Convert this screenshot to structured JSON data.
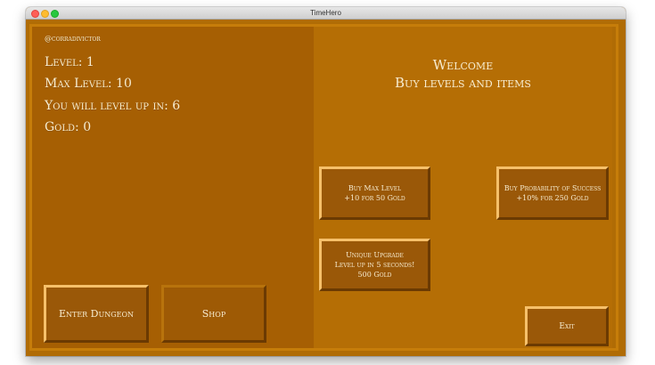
{
  "window": {
    "title": "TimeHero"
  },
  "player": {
    "username": "@corradivictor",
    "level": "Level: 1",
    "max_level": "Max Level: 10",
    "level_up": "You will level up in: 6",
    "gold": "Gold: 0"
  },
  "shop": {
    "welcome_line1": "Welcome",
    "welcome_line2": "Buy levels and items",
    "buy_max_level": {
      "line1": "Buy Max Level",
      "line2": "+10 for 50 Gold"
    },
    "buy_probability": {
      "line1": "Buy Probability of Success",
      "line2": "+10% for 250 Gold"
    },
    "unique_upgrade": {
      "line1": "Unique Upgrade",
      "line2": "Level up in 5 seconds!",
      "line3": "500 Gold"
    }
  },
  "actions": {
    "enter_dungeon": "Enter Dungeon",
    "shop": "Shop",
    "exit": "Exit"
  },
  "colors": {
    "background": "#b06c05",
    "left_panel": "#a65f03",
    "button": "#9a5808",
    "text": "#f7ecd0"
  }
}
